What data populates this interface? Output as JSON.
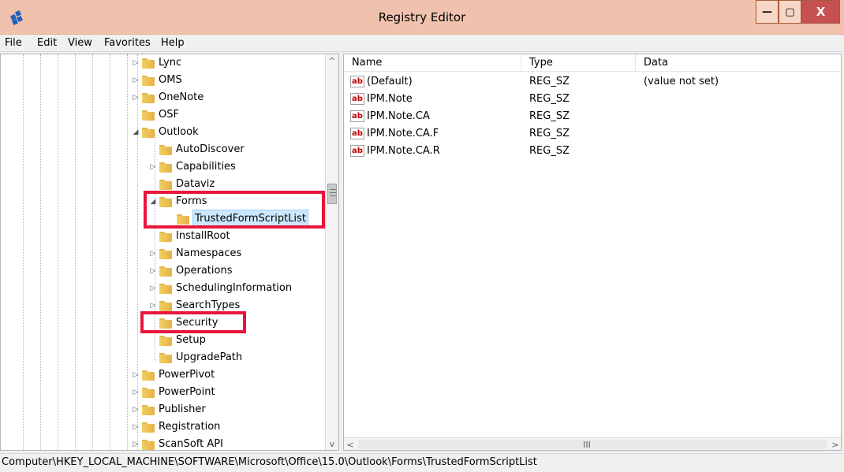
{
  "window": {
    "title": "Registry Editor",
    "controls": [
      "—",
      "▢",
      "X"
    ]
  },
  "menubar": [
    "File",
    "Edit",
    "View",
    "Favorites",
    "Help"
  ],
  "tree": {
    "items": [
      {
        "label": "Lync",
        "expander": "▷"
      },
      {
        "label": "OMS",
        "expander": "▷"
      },
      {
        "label": "OneNote",
        "expander": "▷"
      },
      {
        "label": "OSF",
        "expander": ""
      },
      {
        "label": "Outlook",
        "expander": "◢"
      },
      {
        "label": "AutoDiscover",
        "expander": ""
      },
      {
        "label": "Capabilities",
        "expander": "▷"
      },
      {
        "label": "Dataviz",
        "expander": ""
      },
      {
        "label": "Forms",
        "expander": "◢"
      },
      {
        "label": "TrustedFormScriptList",
        "expander": ""
      },
      {
        "label": "InstallRoot",
        "expander": ""
      },
      {
        "label": "Namespaces",
        "expander": "▷"
      },
      {
        "label": "Operations",
        "expander": "▷"
      },
      {
        "label": "SchedulingInformation",
        "expander": "▷"
      },
      {
        "label": "SearchTypes",
        "expander": "▷"
      },
      {
        "label": "Security",
        "expander": ""
      },
      {
        "label": "Setup",
        "expander": ""
      },
      {
        "label": "UpgradePath",
        "expander": ""
      },
      {
        "label": "PowerPivot",
        "expander": "▷"
      },
      {
        "label": "PowerPoint",
        "expander": "▷"
      },
      {
        "label": "Publisher",
        "expander": "▷"
      },
      {
        "label": "Registration",
        "expander": "▷"
      },
      {
        "label": "ScanSoft API",
        "expander": "▷"
      }
    ]
  },
  "list": {
    "headers": [
      "Name",
      "Type",
      "Data"
    ],
    "rows": [
      {
        "name": "(Default)",
        "type": "REG_SZ",
        "data": "(value not set)"
      },
      {
        "name": "IPM.Note",
        "type": "REG_SZ",
        "data": ""
      },
      {
        "name": "IPM.Note.CA",
        "type": "REG_SZ",
        "data": ""
      },
      {
        "name": "IPM.Note.CA.F",
        "type": "REG_SZ",
        "data": ""
      },
      {
        "name": "IPM.Note.CA.R",
        "type": "REG_SZ",
        "data": ""
      }
    ],
    "value_icon": "ab"
  },
  "scroll": {
    "up": "^",
    "down": "v",
    "left": "<",
    "right": ">",
    "thumb": "III"
  },
  "statusbar": {
    "path": "Computer\\HKEY_LOCAL_MACHINE\\SOFTWARE\\Microsoft\\Office\\15.0\\Outlook\\Forms\\TrustedFormScriptList"
  },
  "colors": {
    "titlebar": "#f0c2ad",
    "close": "#c75050",
    "highlight": "#e8153c",
    "selection": "#cce8ff"
  }
}
